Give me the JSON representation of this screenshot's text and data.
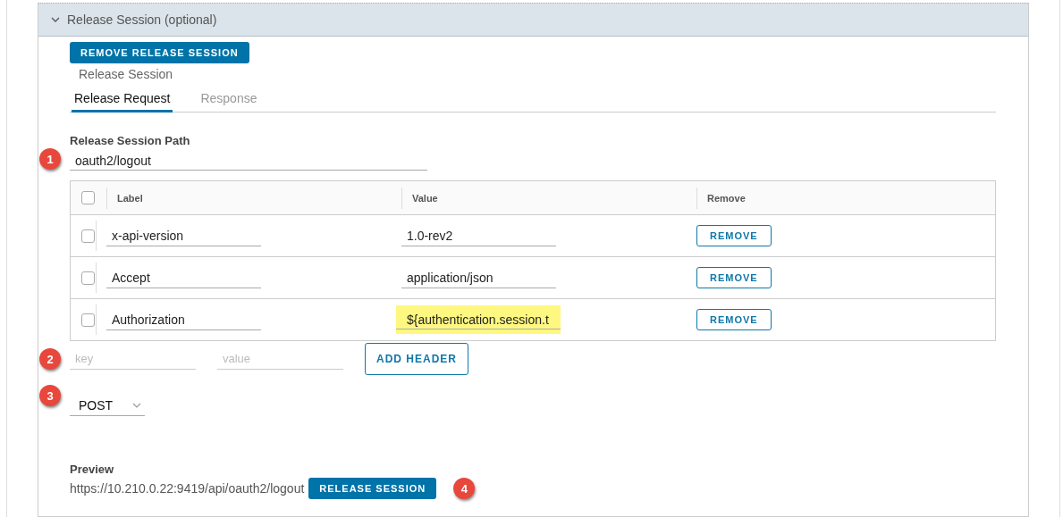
{
  "section": {
    "title": "Release Session (optional)",
    "expanded": true
  },
  "remove_button": "REMOVE RELEASE SESSION",
  "subtitle": "Release Session",
  "tabs": [
    {
      "label": "Release Request",
      "selected": true
    },
    {
      "label": "Response",
      "selected": false
    }
  ],
  "path": {
    "label": "Release Session Path",
    "value": "oauth2/logout",
    "callout": "1"
  },
  "headers_table": {
    "columns": [
      "Label",
      "Value",
      "Remove"
    ],
    "all_checked": false,
    "rows": [
      {
        "checked": false,
        "label": "x-api-version",
        "value": "1.0-rev2",
        "highlighted": false,
        "button": "REMOVE"
      },
      {
        "checked": false,
        "label": "Accept",
        "value": "application/json",
        "highlighted": false,
        "button": "REMOVE"
      },
      {
        "checked": false,
        "label": "Authorization",
        "value": "${authentication.session.t",
        "highlighted": true,
        "button": "REMOVE"
      }
    ]
  },
  "new_header": {
    "key_placeholder": "key",
    "value_placeholder": "value",
    "button": "ADD HEADER",
    "callout": "2"
  },
  "method": {
    "value": "POST",
    "callout": "3"
  },
  "preview": {
    "label": "Preview",
    "url": "https://10.210.0.22:9419/api/oauth2/logout",
    "button": "RELEASE SESSION",
    "callout": "4"
  }
}
